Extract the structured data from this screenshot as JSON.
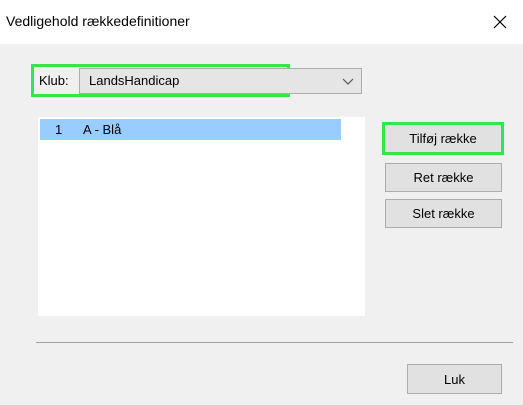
{
  "window": {
    "title": "Vedligehold rækkedefinitioner"
  },
  "club": {
    "label": "Klub:",
    "selected": "LandsHandicap"
  },
  "rows": [
    {
      "number": "1",
      "name": "A - Blå"
    }
  ],
  "buttons": {
    "add": "Tilføj række",
    "edit": "Ret række",
    "delete": "Slet række",
    "close": "Luk"
  },
  "colors": {
    "highlight": "#33e64d",
    "selection": "#99ccff"
  },
  "icons": {
    "close": "close-icon",
    "dropdown": "chevron-down-icon"
  }
}
